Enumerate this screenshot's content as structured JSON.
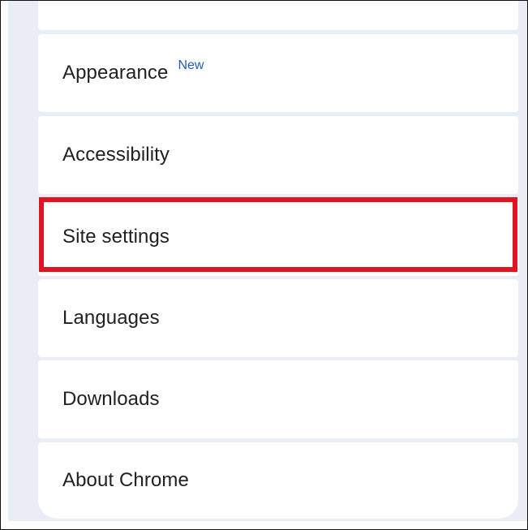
{
  "settings_list": {
    "items": [
      {
        "label": "Appearance",
        "badge": "New"
      },
      {
        "label": "Accessibility"
      },
      {
        "label": "Site settings"
      },
      {
        "label": "Languages"
      },
      {
        "label": "Downloads"
      },
      {
        "label": "About Chrome"
      }
    ]
  },
  "annotation": {
    "highlight_color": "#e0141e",
    "highlighted_item": "Site settings"
  },
  "colors": {
    "panel_background": "#e8edf6",
    "card_background": "#ffffff",
    "text": "#202124",
    "badge": "#1a5fb4"
  }
}
